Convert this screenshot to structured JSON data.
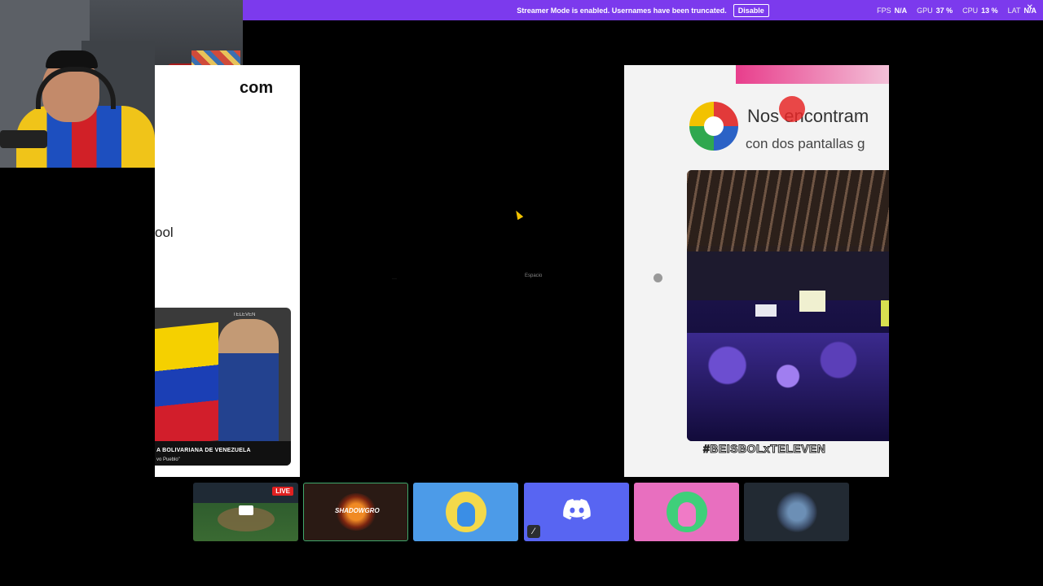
{
  "streamer_bar": {
    "notice": "Streamer Mode is enabled. Usernames have been truncated.",
    "disable_label": "Disable"
  },
  "stats": {
    "fps_label": "FPS",
    "fps_value": "N/A",
    "gpu_label": "GPU",
    "gpu_value": "37 %",
    "cpu_label": "CPU",
    "cpu_value": "13 %",
    "lat_label": "LAT",
    "lat_value": "N/A",
    "close_icon": "✕"
  },
  "left_panel": {
    "text_top": "com",
    "text_mid": "ool",
    "thumb_brand": "TELEVEN",
    "thumb_caption_1": "A BOLIVARIANA DE VENEZUELA",
    "thumb_caption_2": "vo Pueblo\""
  },
  "center": {
    "dot_text": "···",
    "label": "Espacio"
  },
  "right_panel": {
    "title": "Nos encontram",
    "subtitle": "con dos pantallas g",
    "hashtag": "#BEISBOLxTELEVEN"
  },
  "tiles": {
    "stream_live_badge": "LIVE",
    "shadow_label": "SHADOWGRO",
    "mute_icon": "⁄"
  },
  "colors": {
    "streamer_bar": "#7c3aed",
    "discord_blurple": "#5865f2",
    "live_red": "#e02020"
  }
}
